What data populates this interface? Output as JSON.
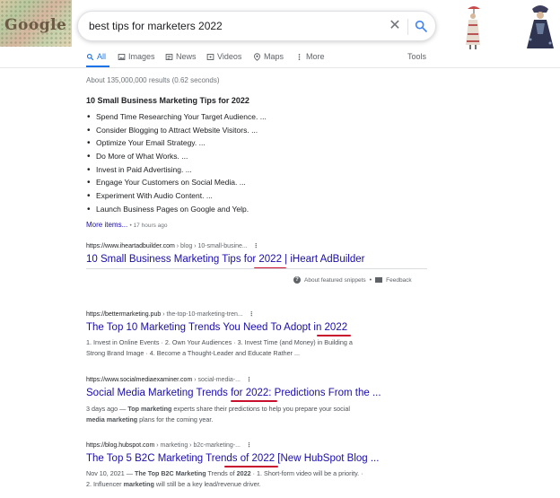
{
  "search": {
    "query": "best tips for marketers 2022",
    "logo_text": "Google"
  },
  "tabs": [
    {
      "label": "All",
      "icon": "search-icon"
    },
    {
      "label": "Images",
      "icon": "image-icon"
    },
    {
      "label": "News",
      "icon": "news-icon"
    },
    {
      "label": "Videos",
      "icon": "video-icon"
    },
    {
      "label": "Maps",
      "icon": "map-pin-icon"
    },
    {
      "label": "More",
      "icon": "more-vert-icon"
    }
  ],
  "tools_label": "Tools",
  "results_count": "About 135,000,000 results (0.62 seconds)",
  "featured_snippet": {
    "title": "10 Small Business Marketing Tips for 2022",
    "items": [
      "Spend Time Researching Your Target Audience. ...",
      "Consider Blogging to Attract Website Visitors. ...",
      "Optimize Your Email Strategy. ...",
      "Do More of What Works. ...",
      "Invest in Paid Advertising. ...",
      "Engage Your Customers on Social Media. ...",
      "Experiment With Audio Content. ...",
      "Launch Business Pages on Google and Yelp."
    ],
    "more_items": "More items...",
    "time_ago": "17 hours ago",
    "source_domain": "https://www.iheartadbuilder.com",
    "source_path": " › blog › 10-small-busine...",
    "source_title": "10 Small Business Marketing Tips for 2022 | iHeart AdBuilder",
    "about_label": "About featured snippets",
    "feedback_label": "Feedback"
  },
  "results": [
    {
      "domain": "https://bettermarketing.pub",
      "path": " › the-top-10-marketing-tren...",
      "title": "The Top 10 Marketing Trends You Need To Adopt in 2022",
      "desc_line1": "1. Invest in Online Events · 2. Own Your Audiences · 3. Invest Time (and Money) in Building a",
      "desc_line2": "Strong Brand Image · 4. Become a Thought-Leader and Educate Rather ..."
    },
    {
      "domain": "https://www.socialmediaexaminer.com",
      "path": " › social-media-...",
      "title": "Social Media Marketing Trends for 2022: Predictions From the ...",
      "desc_date": "3 days ago",
      "desc_a": " — ",
      "desc_b1": "Top marketing",
      "desc_c": " experts share their predictions to help you prepare your social",
      "desc_b2": "media marketing",
      "desc_d": " plans for the coming year."
    },
    {
      "domain": "https://blog.hubspot.com",
      "path": " › marketing › b2c-marketing-...",
      "title": "The Top 5 B2C Marketing Trends of 2022 [New HubSpot Blog ...",
      "desc_date": "Nov 10, 2021",
      "desc_a": " — ",
      "desc_b1": "The Top B2C Marketing",
      "desc_c": " Trends of ",
      "desc_b2": "2022",
      "desc_d": " · 1. Short-form video will be a priority. ·",
      "desc_line2_a": "2. Influencer ",
      "desc_line2_b": "marketing",
      "desc_line2_c": " will still be a key lead/revenue driver."
    }
  ],
  "colors": {
    "link": "#1a0dab",
    "accent": "#1a73e8",
    "annotation": "#c8102e"
  }
}
